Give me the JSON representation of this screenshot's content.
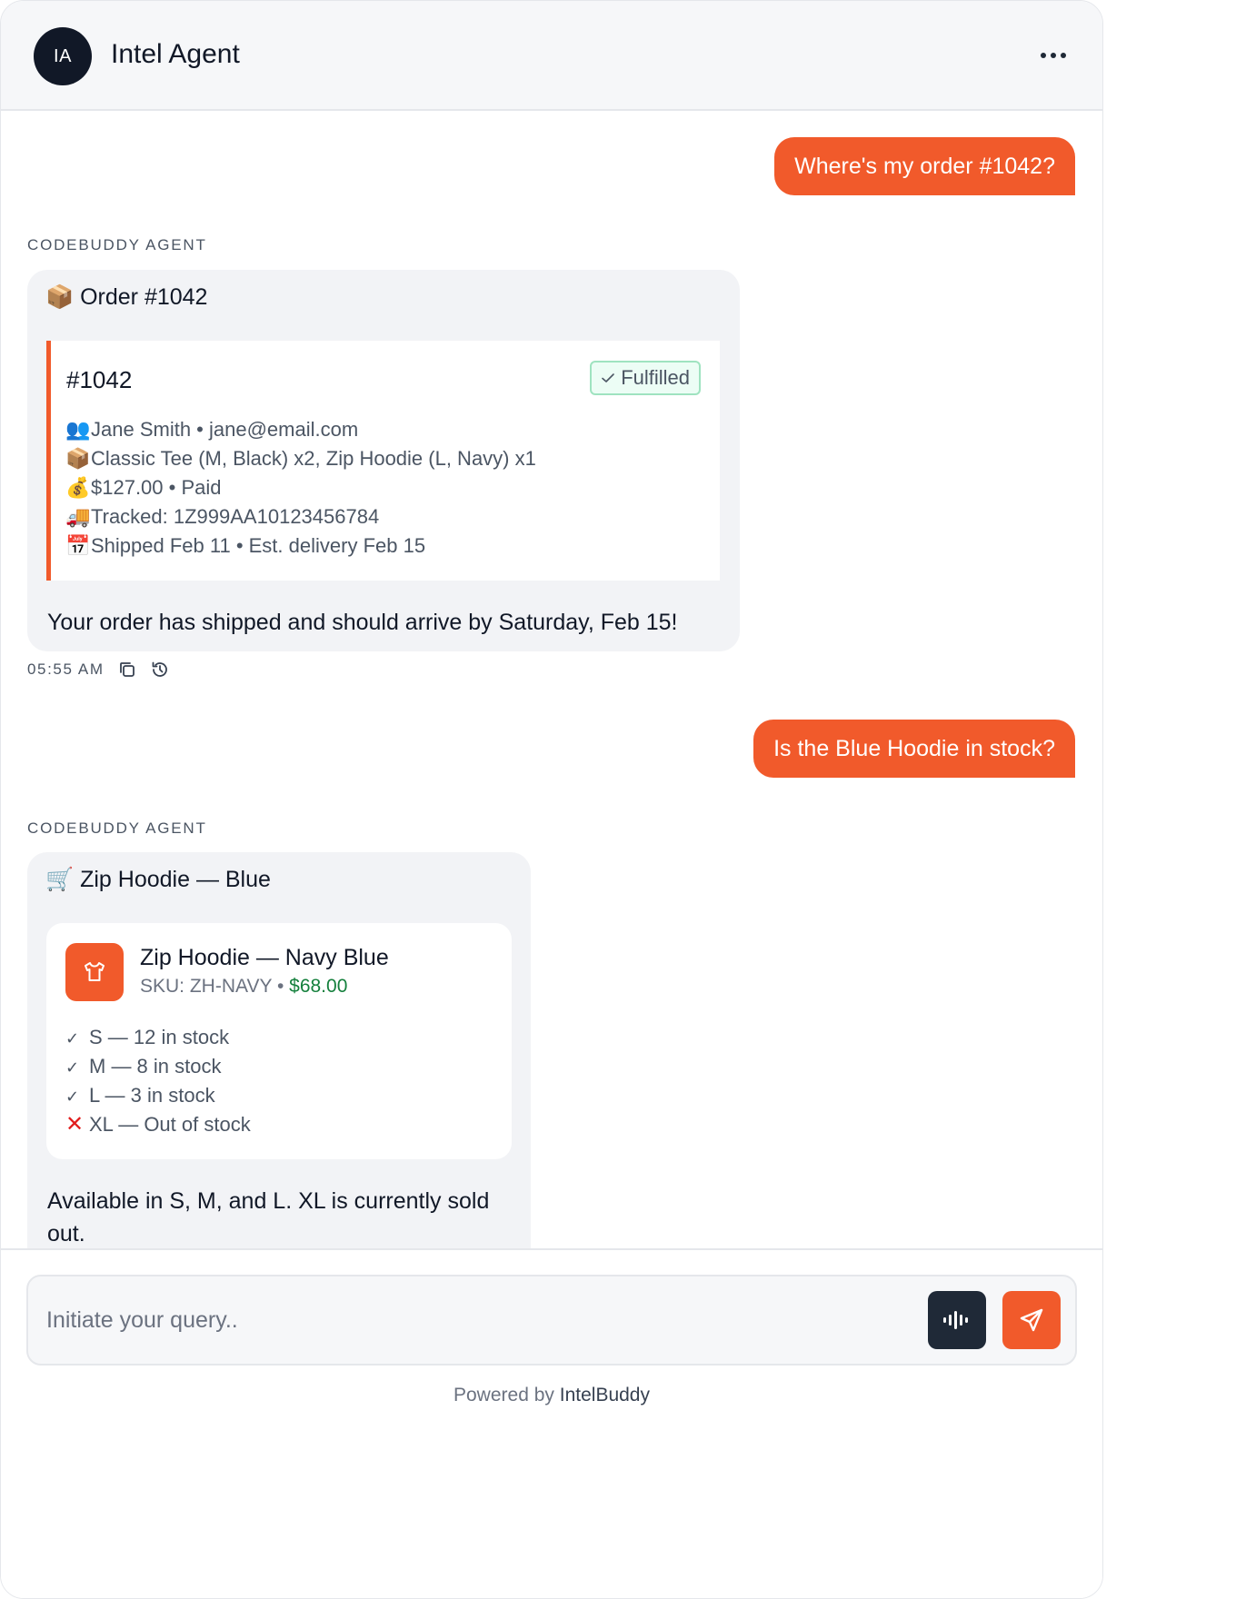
{
  "header": {
    "avatar_initials": "IA",
    "agent_name": "Intel Agent",
    "more_icon": "more-horizontal-icon"
  },
  "conversation": [
    {
      "role": "user",
      "text": "Where's my order #1042?"
    },
    {
      "role": "agent",
      "sender": "CODEBUDDY AGENT",
      "title_emoji": "📦",
      "title": "Order #1042",
      "order": {
        "id": "#1042",
        "status": "Fulfilled",
        "lines": [
          {
            "emoji": "👥",
            "text": "Jane Smith • jane@email.com"
          },
          {
            "emoji": "📦",
            "text": "Classic Tee (M, Black) x2, Zip Hoodie (L, Navy) x1"
          },
          {
            "emoji": "💰",
            "text": "$127.00 • Paid"
          },
          {
            "emoji": "🚚",
            "text": "Tracked: 1Z999AA10123456784"
          },
          {
            "emoji": "📅",
            "text": "Shipped Feb 11 • Est. delivery Feb 15"
          }
        ]
      },
      "text": "Your order has shipped and should arrive by Saturday, Feb 15!",
      "timestamp": "05:55 AM"
    },
    {
      "role": "user",
      "text": "Is the Blue Hoodie in stock?"
    },
    {
      "role": "agent",
      "sender": "CODEBUDDY AGENT",
      "title_emoji": "🛒",
      "title": "Zip Hoodie — Blue",
      "product": {
        "name": "Zip Hoodie — Navy Blue",
        "sku": "SKU: ZH-NAVY",
        "separator": "•",
        "price": "$68.00",
        "stock": [
          {
            "available": true,
            "text": "S — 12 in stock"
          },
          {
            "available": true,
            "text": "M — 8 in stock"
          },
          {
            "available": true,
            "text": "L — 3 in stock"
          },
          {
            "available": false,
            "text": "XL — Out of stock"
          }
        ]
      },
      "text": "Available in S, M, and L. XL is currently sold out."
    }
  ],
  "composer": {
    "placeholder": "Initiate your query..",
    "voice_icon": "audio-wave-icon",
    "send_icon": "send-icon"
  },
  "footer": {
    "powered_prefix": "Powered by",
    "brand": "IntelBuddy"
  },
  "colors": {
    "accent": "#f15a2b",
    "dark": "#1f2937",
    "success": "#15803d",
    "error": "#e11d1d"
  }
}
